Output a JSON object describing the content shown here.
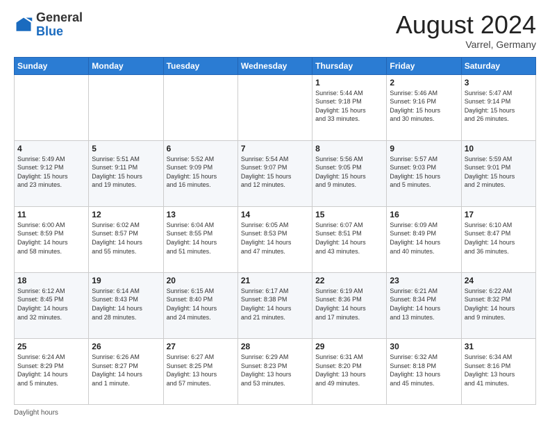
{
  "header": {
    "logo": {
      "general": "General",
      "blue": "Blue"
    },
    "month_title": "August 2024",
    "subtitle": "Varrel, Germany"
  },
  "days_of_week": [
    "Sunday",
    "Monday",
    "Tuesday",
    "Wednesday",
    "Thursday",
    "Friday",
    "Saturday"
  ],
  "weeks": [
    [
      {
        "day": "",
        "info": ""
      },
      {
        "day": "",
        "info": ""
      },
      {
        "day": "",
        "info": ""
      },
      {
        "day": "",
        "info": ""
      },
      {
        "day": "1",
        "info": "Sunrise: 5:44 AM\nSunset: 9:18 PM\nDaylight: 15 hours\nand 33 minutes."
      },
      {
        "day": "2",
        "info": "Sunrise: 5:46 AM\nSunset: 9:16 PM\nDaylight: 15 hours\nand 30 minutes."
      },
      {
        "day": "3",
        "info": "Sunrise: 5:47 AM\nSunset: 9:14 PM\nDaylight: 15 hours\nand 26 minutes."
      }
    ],
    [
      {
        "day": "4",
        "info": "Sunrise: 5:49 AM\nSunset: 9:12 PM\nDaylight: 15 hours\nand 23 minutes."
      },
      {
        "day": "5",
        "info": "Sunrise: 5:51 AM\nSunset: 9:11 PM\nDaylight: 15 hours\nand 19 minutes."
      },
      {
        "day": "6",
        "info": "Sunrise: 5:52 AM\nSunset: 9:09 PM\nDaylight: 15 hours\nand 16 minutes."
      },
      {
        "day": "7",
        "info": "Sunrise: 5:54 AM\nSunset: 9:07 PM\nDaylight: 15 hours\nand 12 minutes."
      },
      {
        "day": "8",
        "info": "Sunrise: 5:56 AM\nSunset: 9:05 PM\nDaylight: 15 hours\nand 9 minutes."
      },
      {
        "day": "9",
        "info": "Sunrise: 5:57 AM\nSunset: 9:03 PM\nDaylight: 15 hours\nand 5 minutes."
      },
      {
        "day": "10",
        "info": "Sunrise: 5:59 AM\nSunset: 9:01 PM\nDaylight: 15 hours\nand 2 minutes."
      }
    ],
    [
      {
        "day": "11",
        "info": "Sunrise: 6:00 AM\nSunset: 8:59 PM\nDaylight: 14 hours\nand 58 minutes."
      },
      {
        "day": "12",
        "info": "Sunrise: 6:02 AM\nSunset: 8:57 PM\nDaylight: 14 hours\nand 55 minutes."
      },
      {
        "day": "13",
        "info": "Sunrise: 6:04 AM\nSunset: 8:55 PM\nDaylight: 14 hours\nand 51 minutes."
      },
      {
        "day": "14",
        "info": "Sunrise: 6:05 AM\nSunset: 8:53 PM\nDaylight: 14 hours\nand 47 minutes."
      },
      {
        "day": "15",
        "info": "Sunrise: 6:07 AM\nSunset: 8:51 PM\nDaylight: 14 hours\nand 43 minutes."
      },
      {
        "day": "16",
        "info": "Sunrise: 6:09 AM\nSunset: 8:49 PM\nDaylight: 14 hours\nand 40 minutes."
      },
      {
        "day": "17",
        "info": "Sunrise: 6:10 AM\nSunset: 8:47 PM\nDaylight: 14 hours\nand 36 minutes."
      }
    ],
    [
      {
        "day": "18",
        "info": "Sunrise: 6:12 AM\nSunset: 8:45 PM\nDaylight: 14 hours\nand 32 minutes."
      },
      {
        "day": "19",
        "info": "Sunrise: 6:14 AM\nSunset: 8:43 PM\nDaylight: 14 hours\nand 28 minutes."
      },
      {
        "day": "20",
        "info": "Sunrise: 6:15 AM\nSunset: 8:40 PM\nDaylight: 14 hours\nand 24 minutes."
      },
      {
        "day": "21",
        "info": "Sunrise: 6:17 AM\nSunset: 8:38 PM\nDaylight: 14 hours\nand 21 minutes."
      },
      {
        "day": "22",
        "info": "Sunrise: 6:19 AM\nSunset: 8:36 PM\nDaylight: 14 hours\nand 17 minutes."
      },
      {
        "day": "23",
        "info": "Sunrise: 6:21 AM\nSunset: 8:34 PM\nDaylight: 14 hours\nand 13 minutes."
      },
      {
        "day": "24",
        "info": "Sunrise: 6:22 AM\nSunset: 8:32 PM\nDaylight: 14 hours\nand 9 minutes."
      }
    ],
    [
      {
        "day": "25",
        "info": "Sunrise: 6:24 AM\nSunset: 8:29 PM\nDaylight: 14 hours\nand 5 minutes."
      },
      {
        "day": "26",
        "info": "Sunrise: 6:26 AM\nSunset: 8:27 PM\nDaylight: 14 hours\nand 1 minute."
      },
      {
        "day": "27",
        "info": "Sunrise: 6:27 AM\nSunset: 8:25 PM\nDaylight: 13 hours\nand 57 minutes."
      },
      {
        "day": "28",
        "info": "Sunrise: 6:29 AM\nSunset: 8:23 PM\nDaylight: 13 hours\nand 53 minutes."
      },
      {
        "day": "29",
        "info": "Sunrise: 6:31 AM\nSunset: 8:20 PM\nDaylight: 13 hours\nand 49 minutes."
      },
      {
        "day": "30",
        "info": "Sunrise: 6:32 AM\nSunset: 8:18 PM\nDaylight: 13 hours\nand 45 minutes."
      },
      {
        "day": "31",
        "info": "Sunrise: 6:34 AM\nSunset: 8:16 PM\nDaylight: 13 hours\nand 41 minutes."
      }
    ]
  ],
  "footer": {
    "daylight_label": "Daylight hours"
  }
}
